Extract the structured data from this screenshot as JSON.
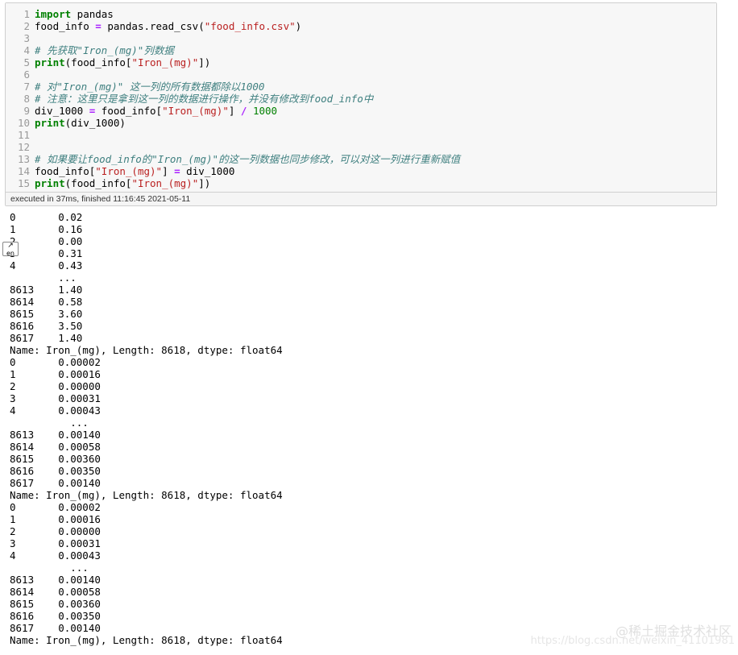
{
  "cell": {
    "lines": [
      [
        {
          "t": "kw",
          "v": "import"
        },
        {
          "t": "",
          "v": " pandas"
        }
      ],
      [
        {
          "t": "",
          "v": "food_info "
        },
        {
          "t": "op",
          "v": "="
        },
        {
          "t": "",
          "v": " pandas.read_csv("
        },
        {
          "t": "str",
          "v": "\"food_info.csv\""
        },
        {
          "t": "",
          "v": ")"
        }
      ],
      [],
      [
        {
          "t": "cm",
          "v": "# 先获取\"Iron_(mg)\"列数据"
        }
      ],
      [
        {
          "t": "kw",
          "v": "print"
        },
        {
          "t": "",
          "v": "(food_info["
        },
        {
          "t": "str",
          "v": "\"Iron_(mg)\""
        },
        {
          "t": "",
          "v": "])"
        }
      ],
      [],
      [
        {
          "t": "cm",
          "v": "# 对\"Iron_(mg)\" 这一列的所有数据都除以1000"
        }
      ],
      [
        {
          "t": "cm",
          "v": "# 注意：这里只是拿到这一列的数据进行操作，并没有修改到food_info中"
        }
      ],
      [
        {
          "t": "",
          "v": "div_1000 "
        },
        {
          "t": "op",
          "v": "="
        },
        {
          "t": "",
          "v": " food_info["
        },
        {
          "t": "str",
          "v": "\"Iron_(mg)\""
        },
        {
          "t": "",
          "v": "] "
        },
        {
          "t": "op",
          "v": "/"
        },
        {
          "t": "",
          "v": " "
        },
        {
          "t": "num",
          "v": "1000"
        }
      ],
      [
        {
          "t": "kw",
          "v": "print"
        },
        {
          "t": "",
          "v": "(div_1000)"
        }
      ],
      [],
      [],
      [
        {
          "t": "cm",
          "v": "# 如果要让food_info的\"Iron_(mg)\"的这一列数据也同步修改，可以对这一列进行重新赋值"
        }
      ],
      [
        {
          "t": "",
          "v": "food_info["
        },
        {
          "t": "str",
          "v": "\"Iron_(mg)\""
        },
        {
          "t": "",
          "v": "] "
        },
        {
          "t": "op",
          "v": "="
        },
        {
          "t": "",
          "v": " div_1000"
        }
      ],
      [
        {
          "t": "kw",
          "v": "print"
        },
        {
          "t": "",
          "v": "(food_info["
        },
        {
          "t": "str",
          "v": "\"Iron_(mg)\""
        },
        {
          "t": "",
          "v": "])"
        }
      ]
    ],
    "line_numbers": [
      "1",
      "2",
      "3",
      "4",
      "5",
      "6",
      "7",
      "8",
      "9",
      "10",
      "11",
      "12",
      "13",
      "14",
      "15"
    ],
    "exec_status": "executed in 37ms, finished 11:16:45 2021-05-11"
  },
  "output": [
    "0       0.02",
    "1       0.16",
    "2       0.00",
    "3       0.31",
    "4       0.43",
    "        ...",
    "8613    1.40",
    "8614    0.58",
    "8615    3.60",
    "8616    3.50",
    "8617    1.40",
    "Name: Iron_(mg), Length: 8618, dtype: float64",
    "0       0.00002",
    "1       0.00016",
    "2       0.00000",
    "3       0.00031",
    "4       0.00043",
    "          ...",
    "8613    0.00140",
    "8614    0.00058",
    "8615    0.00360",
    "8616    0.00350",
    "8617    0.00140",
    "Name: Iron_(mg), Length: 8618, dtype: float64",
    "0       0.00002",
    "1       0.00016",
    "2       0.00000",
    "3       0.00031",
    "4       0.00043",
    "          ...",
    "8613    0.00140",
    "8614    0.00058",
    "8615    0.00360",
    "8616    0.00350",
    "8617    0.00140",
    "Name: Iron_(mg), Length: 8618, dtype: float64"
  ],
  "widget_label": "en",
  "watermark": "@稀土掘金技术社区",
  "watermark_url": "https://blog.csdn.net/weixin_41101981"
}
